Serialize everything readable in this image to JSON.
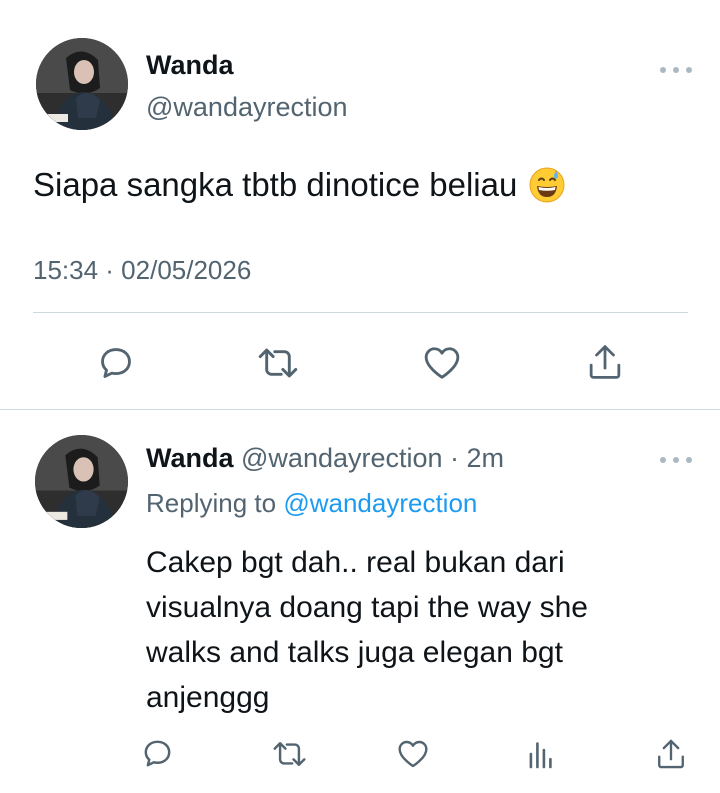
{
  "main_tweet": {
    "author_name": "Wanda",
    "author_handle": "@wandayrection",
    "text": "Siapa sangka tbtb dinotice beliau",
    "emoji": "grinning-face-with-sweat-emoji",
    "timestamp": "15:34 · 02/05/2026",
    "actions": [
      "reply-icon",
      "retweet-icon",
      "like-icon",
      "share-icon"
    ]
  },
  "reply_tweet": {
    "author_name": "Wanda",
    "author_handle": "@wandayrection",
    "separator": " · ",
    "age": "2m",
    "replying_prefix": "Replying to ",
    "replying_to": "@wandayrection",
    "text_lines": [
      "Cakep bgt dah.. real bukan dari",
      "visualnya doang tapi the way she",
      "walks and talks juga elegan bgt",
      "anjenggg"
    ],
    "actions": [
      "reply-icon",
      "retweet-icon",
      "like-icon",
      "analytics-icon",
      "share-icon"
    ]
  },
  "colors": {
    "text_primary": "#0f1419",
    "text_secondary": "#536471",
    "link": "#1d9bf0",
    "icon": "#536471",
    "divider": "#cfd9de"
  }
}
